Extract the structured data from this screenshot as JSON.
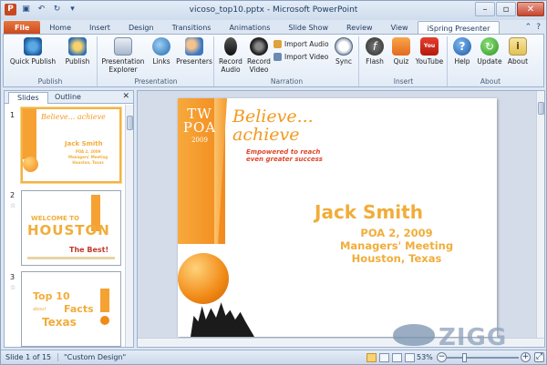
{
  "window": {
    "title": "vicoso_top10.pptx - Microsoft PowerPoint"
  },
  "tabs": [
    "File",
    "Home",
    "Insert",
    "Design",
    "Transitions",
    "Animations",
    "Slide Show",
    "Review",
    "View",
    "iSpring Presenter"
  ],
  "active_tab": "iSpring Presenter",
  "ribbon": {
    "groups": [
      {
        "label": "Publish",
        "buttons": [
          "Quick Publish",
          "Publish"
        ]
      },
      {
        "label": "Presentation",
        "buttons": [
          "Presentation Explorer",
          "Links",
          "Presenters"
        ]
      },
      {
        "label": "Narration",
        "buttons": [
          "Record Audio",
          "Record Video",
          "Import Audio",
          "Import Video",
          "Sync"
        ]
      },
      {
        "label": "Insert",
        "buttons": [
          "Flash",
          "Quiz",
          "YouTube"
        ]
      },
      {
        "label": "About",
        "buttons": [
          "Help",
          "Update",
          "About"
        ]
      }
    ]
  },
  "pane": {
    "tabs": [
      "Slides",
      "Outline"
    ],
    "active": "Slides"
  },
  "thumbnails": [
    {
      "num": "1",
      "title": "Jack Smith",
      "lines": [
        "POA 2, 2009",
        "Managers' Meeting",
        "Houston, Texas"
      ],
      "tagline": "Believe... achieve"
    },
    {
      "num": "2",
      "welcome": "WELCOME TO",
      "city": "HOUSTON",
      "tag": "The Best!"
    },
    {
      "num": "3",
      "top": "Top 10",
      "facts": "Facts",
      "about": "about",
      "texas": "Texas"
    }
  ],
  "slide": {
    "banner_top": "TW",
    "banner_mid": "POA",
    "banner_year": "2009",
    "tagline1": "Believe...",
    "tagline2": "achieve",
    "sub1": "Empowered to reach",
    "sub2": "even greater success",
    "name": "Jack Smith",
    "line1": "POA 2, 2009",
    "line2": "Managers' Meeting",
    "line3": "Houston, Texas"
  },
  "status": {
    "slide": "Slide 1 of 15",
    "theme": "\"Custom Design\"",
    "zoom": "53%"
  },
  "watermark": "ZIGG",
  "colors": {
    "accent": "#f1ad3a",
    "file_tab": "#d5541f",
    "red_text": "#e0462a"
  }
}
